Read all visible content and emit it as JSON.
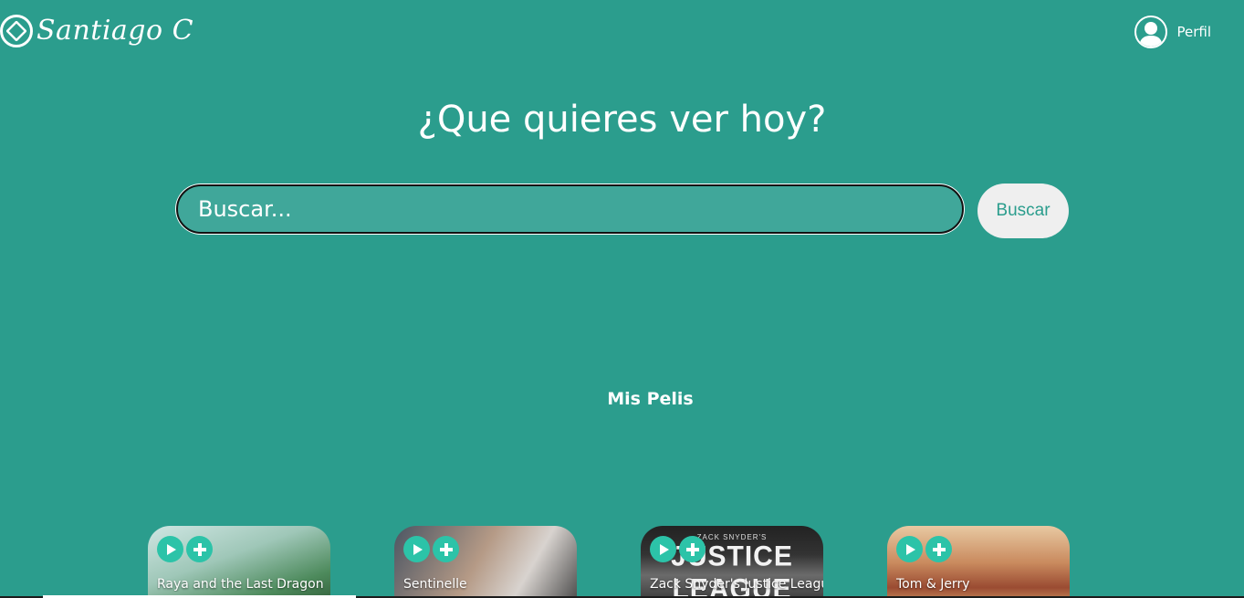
{
  "header": {
    "logo_text": "Santiago C",
    "profile_label": "Perfil"
  },
  "hero": {
    "title": "¿Que quieres ver hoy?"
  },
  "search": {
    "placeholder": "Buscar...",
    "button_label": "Buscar"
  },
  "section": {
    "title": "Mis Pelis"
  },
  "movies": [
    {
      "title": "Raya and the Last Dragon"
    },
    {
      "title": "Sentinelle"
    },
    {
      "title": "Zack Snyder's Justice League",
      "poster_text": "JUSTICE LEAGUE",
      "poster_subtext": "ZACK SNYDER'S"
    },
    {
      "title": "Tom & Jerry"
    }
  ],
  "icons": {
    "logo": "code-diamond-icon",
    "profile": "user-avatar-icon",
    "play": "play-icon",
    "add": "plus-icon"
  },
  "colors": {
    "background": "#2b9d8d",
    "search_field": "#40a79a",
    "button_bg": "#efefef",
    "accent": "#2cc3a8"
  }
}
